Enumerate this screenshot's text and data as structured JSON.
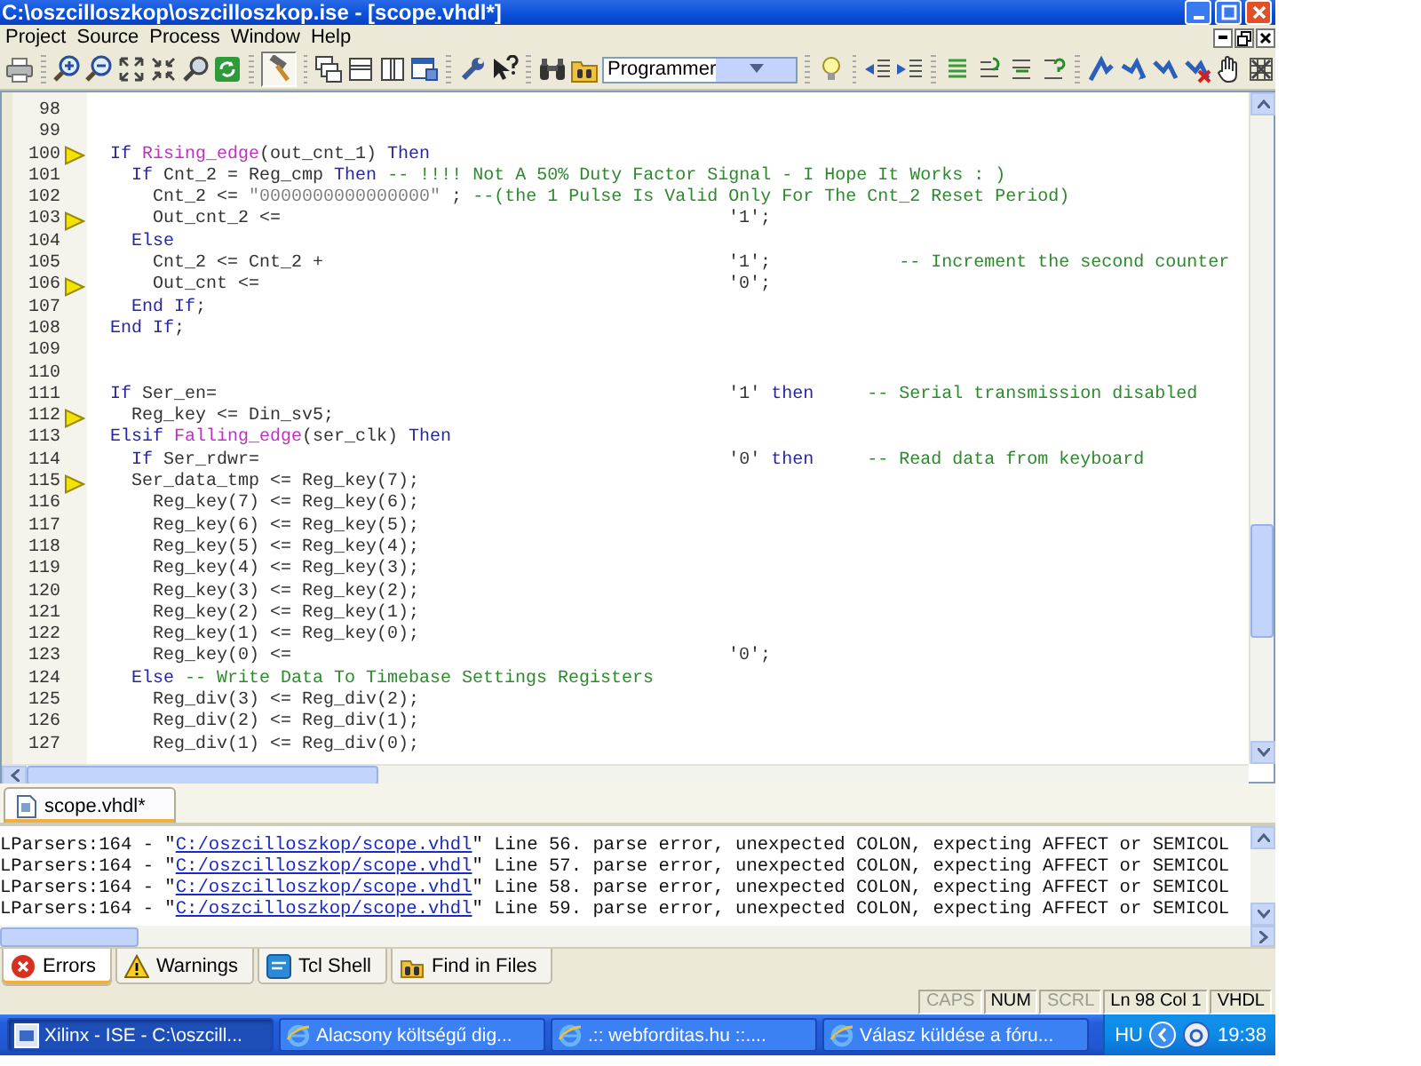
{
  "window": {
    "title": "C:\\oszcilloszkop\\oszcilloszkop.ise - [scope.vhdl*]"
  },
  "menu": [
    "Project",
    "Source",
    "Process",
    "Window",
    "Help"
  ],
  "toolbar": {
    "build_button": {
      "pressed": true
    },
    "combo_value": "Programmer"
  },
  "editor": {
    "lines": [
      {
        "number": "98",
        "marker": false
      },
      {
        "number": "99",
        "marker": false
      },
      {
        "number": "100",
        "marker": true,
        "segments": [
          {
            "kind": "kw",
            "text": "If "
          },
          {
            "kind": "fn",
            "text": "Rising_edge"
          },
          {
            "kind": "plain",
            "text": "(out_cnt_1) "
          },
          {
            "kind": "kw",
            "text": "Then"
          }
        ]
      },
      {
        "number": "101",
        "marker": false,
        "segments": [
          {
            "kind": "kw",
            "text": "  If"
          },
          {
            "kind": "plain",
            "text": " Cnt_2 = Reg_cmp "
          },
          {
            "kind": "kw",
            "text": "Then "
          },
          {
            "kind": "comment",
            "text": "-- !!!! Not A 50% Duty Factor Signal - I Hope It Works : )"
          }
        ]
      },
      {
        "number": "102",
        "marker": false,
        "segments": [
          {
            "kind": "plain",
            "text": "    Cnt_2 <= "
          },
          {
            "kind": "str",
            "text": "\"0000000000000000\""
          },
          {
            "kind": "plain",
            "text": " ; "
          },
          {
            "kind": "comment",
            "text": "--(the 1 Pulse Is Valid Only For The Cnt_2 Reset Period)"
          }
        ]
      },
      {
        "number": "103",
        "marker": true,
        "segments": [
          {
            "kind": "plain",
            "text": "    Out_cnt_2 <=                                          '1';"
          }
        ]
      },
      {
        "number": "104",
        "marker": false,
        "segments": [
          {
            "kind": "kw",
            "text": "  Else"
          }
        ]
      },
      {
        "number": "105",
        "marker": false,
        "segments": [
          {
            "kind": "plain",
            "text": "    Cnt_2 <= Cnt_2 +                                      '1';            "
          },
          {
            "kind": "comment",
            "text": "-- Increment the second counter"
          }
        ]
      },
      {
        "number": "106",
        "marker": true,
        "segments": [
          {
            "kind": "plain",
            "text": "    Out_cnt <=                                            '0';"
          }
        ]
      },
      {
        "number": "107",
        "marker": false,
        "segments": [
          {
            "kind": "kw",
            "text": "  End If"
          },
          {
            "kind": "plain",
            "text": ";"
          }
        ]
      },
      {
        "number": "108",
        "marker": false,
        "segments": [
          {
            "kind": "kw",
            "text": "End If"
          },
          {
            "kind": "plain",
            "text": ";"
          }
        ]
      },
      {
        "number": "109",
        "marker": false
      },
      {
        "number": "110",
        "marker": false
      },
      {
        "number": "111",
        "marker": false,
        "segments": [
          {
            "kind": "kw",
            "text": "If"
          },
          {
            "kind": "plain",
            "text": " Ser_en=                                                '1' "
          },
          {
            "kind": "kw",
            "text": "then     "
          },
          {
            "kind": "comment",
            "text": "-- Serial transmission disabled"
          }
        ]
      },
      {
        "number": "112",
        "marker": true,
        "segments": [
          {
            "kind": "plain",
            "text": "  Reg_key <= Din_sv5;"
          }
        ]
      },
      {
        "number": "113",
        "marker": false,
        "segments": [
          {
            "kind": "kw",
            "text": "Elsif "
          },
          {
            "kind": "fn",
            "text": "Falling_edge"
          },
          {
            "kind": "plain",
            "text": "(ser_clk) "
          },
          {
            "kind": "kw",
            "text": "Then"
          }
        ]
      },
      {
        "number": "114",
        "marker": false,
        "segments": [
          {
            "kind": "kw",
            "text": "  If"
          },
          {
            "kind": "plain",
            "text": " Ser_rdwr=                                            '0' "
          },
          {
            "kind": "kw",
            "text": "then     "
          },
          {
            "kind": "comment",
            "text": "-- Read data from keyboard"
          }
        ]
      },
      {
        "number": "115",
        "marker": true,
        "segments": [
          {
            "kind": "plain",
            "text": "  Ser_data_tmp <= Reg_key(7);"
          }
        ]
      },
      {
        "number": "116",
        "marker": false,
        "segments": [
          {
            "kind": "plain",
            "text": "    Reg_key(7) <= Reg_key(6);"
          }
        ]
      },
      {
        "number": "117",
        "marker": false,
        "segments": [
          {
            "kind": "plain",
            "text": "    Reg_key(6) <= Reg_key(5);"
          }
        ]
      },
      {
        "number": "118",
        "marker": false,
        "segments": [
          {
            "kind": "plain",
            "text": "    Reg_key(5) <= Reg_key(4);"
          }
        ]
      },
      {
        "number": "119",
        "marker": false,
        "segments": [
          {
            "kind": "plain",
            "text": "    Reg_key(4) <= Reg_key(3);"
          }
        ]
      },
      {
        "number": "120",
        "marker": false,
        "segments": [
          {
            "kind": "plain",
            "text": "    Reg_key(3) <= Reg_key(2);"
          }
        ]
      },
      {
        "number": "121",
        "marker": false,
        "segments": [
          {
            "kind": "plain",
            "text": "    Reg_key(2) <= Reg_key(1);"
          }
        ]
      },
      {
        "number": "122",
        "marker": false,
        "segments": [
          {
            "kind": "plain",
            "text": "    Reg_key(1) <= Reg_key(0);"
          }
        ]
      },
      {
        "number": "123",
        "marker": false,
        "segments": [
          {
            "kind": "plain",
            "text": "    Reg_key(0) <=                                         '0';"
          }
        ]
      },
      {
        "number": "124",
        "marker": false,
        "segments": [
          {
            "kind": "kw",
            "text": "  Else "
          },
          {
            "kind": "comment",
            "text": "-- Write Data To Timebase Settings Registers"
          }
        ]
      },
      {
        "number": "125",
        "marker": false,
        "segments": [
          {
            "kind": "plain",
            "text": "    Reg_div(3) <= Reg_div(2);"
          }
        ]
      },
      {
        "number": "126",
        "marker": false,
        "segments": [
          {
            "kind": "plain",
            "text": "    Reg_div(2) <= Reg_div(1);"
          }
        ]
      },
      {
        "number": "127",
        "marker": false,
        "segments": [
          {
            "kind": "plain",
            "text": "    Reg_div(1) <= Reg_div(0);"
          }
        ]
      }
    ]
  },
  "document_tabs": [
    {
      "label": "scope.vhdl*",
      "selected": true
    }
  ],
  "console": {
    "lines": [
      {
        "prefix": "LParsers:164 - \"",
        "link": "C:/oszcilloszkop/scope.vhdl",
        "suffix": "\" Line 56. parse error, unexpected COLON, expecting AFFECT or SEMICOL"
      },
      {
        "prefix": "LParsers:164 - \"",
        "link": "C:/oszcilloszkop/scope.vhdl",
        "suffix": "\" Line 57. parse error, unexpected COLON, expecting AFFECT or SEMICOL"
      },
      {
        "prefix": "LParsers:164 - \"",
        "link": "C:/oszcilloszkop/scope.vhdl",
        "suffix": "\" Line 58. parse error, unexpected COLON, expecting AFFECT or SEMICOL"
      },
      {
        "prefix": "LParsers:164 - \"",
        "link": "C:/oszcilloszkop/scope.vhdl",
        "suffix": "\" Line 59. parse error, unexpected COLON, expecting AFFECT or SEMICOL"
      }
    ]
  },
  "console_tabs": [
    {
      "label": "Errors",
      "kind": "errors",
      "selected": true
    },
    {
      "label": "Warnings",
      "kind": "warnings",
      "selected": false
    },
    {
      "label": "Tcl Shell",
      "kind": "tcl",
      "selected": false
    },
    {
      "label": "Find in Files",
      "kind": "find",
      "selected": false
    }
  ],
  "status_bar": [
    {
      "label": "CAPS",
      "on": false
    },
    {
      "label": "NUM",
      "on": true
    },
    {
      "label": "SCRL",
      "on": false
    },
    {
      "label": "Ln 98 Col 1",
      "on": true
    },
    {
      "label": "VHDL",
      "on": true
    }
  ],
  "taskbar": {
    "tasks": [
      {
        "label": "Xilinx - ISE - C:\\oszcill...",
        "kind": "ise",
        "selected": true
      },
      {
        "label": "Alacsony költségű dig...",
        "kind": "browser",
        "selected": false
      },
      {
        "label": ".:: webforditas.hu ::....",
        "kind": "browser",
        "selected": false
      },
      {
        "label": "Válasz küldése a fóru...",
        "kind": "browser",
        "selected": false
      }
    ],
    "language": "HU",
    "clock": "19:38"
  }
}
